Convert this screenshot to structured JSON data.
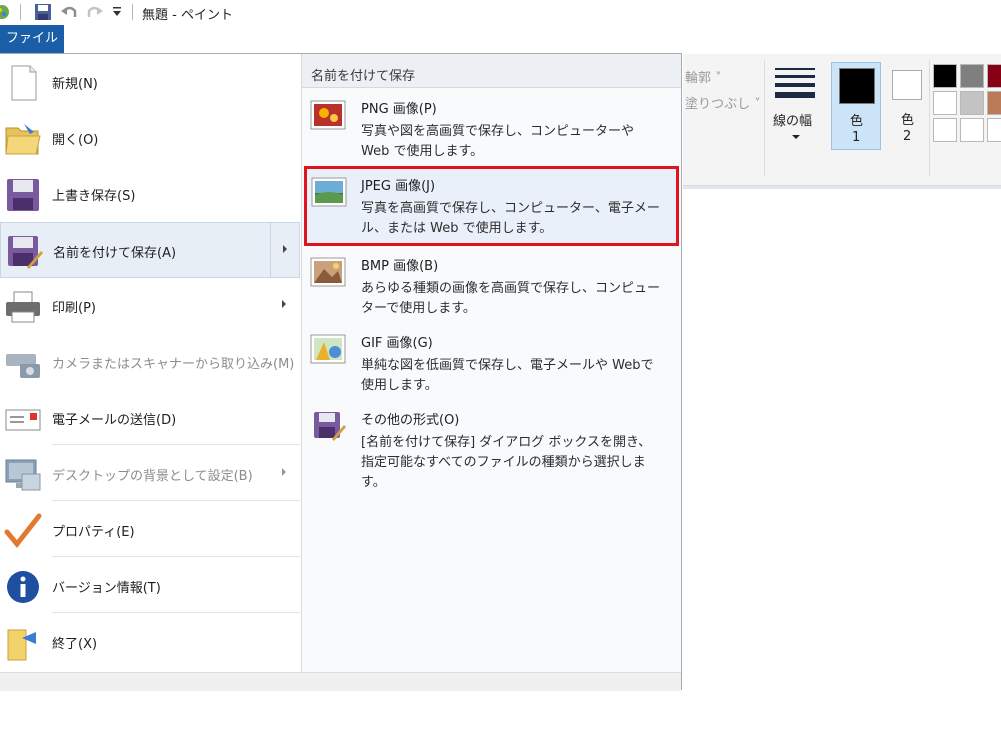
{
  "titlebar": {
    "title": "無題 - ペイント"
  },
  "file_tab": {
    "label": "ファイル"
  },
  "ribbon": {
    "outline_label": "輪郭 ˅",
    "fill_label": "塗りつぶし ˅",
    "line_width_label": "線の幅",
    "color1_label": "色",
    "color1_num": "1",
    "color2_label": "色",
    "color2_num": "2",
    "swatch_colors": [
      "#000000",
      "#7f7f7f",
      "#880015",
      "#ffffff",
      "#c3c3c3",
      "#b97a57",
      "#ffffff",
      "#ffffff",
      "#ffffff"
    ]
  },
  "left_menu": {
    "new": "新規(N)",
    "open": "開く(O)",
    "save": "上書き保存(S)",
    "save_as": "名前を付けて保存(A)",
    "print": "印刷(P)",
    "camera": "カメラまたはスキャナーから取り込み(M)",
    "email": "電子メールの送信(D)",
    "desktop": "デスクトップの背景として設定(B)",
    "properties": "プロパティ(E)",
    "about": "バージョン情報(T)",
    "exit": "終了(X)"
  },
  "right_pane": {
    "header": "名前を付けて保存",
    "items": [
      {
        "title": "PNG 画像(P)",
        "desc": "写真や図を高画質で保存し、コンピューターやWeb で使用します。"
      },
      {
        "title": "JPEG 画像(J)",
        "desc": "写真を高画質で保存し、コンピューター、電子メール、または Web で使用します。"
      },
      {
        "title": "BMP 画像(B)",
        "desc": "あらゆる種類の画像を高画質で保存し、コンピューターで使用します。"
      },
      {
        "title": "GIF 画像(G)",
        "desc": "単純な図を低画質で保存し、電子メールや Webで使用します。"
      },
      {
        "title": "その他の形式(O)",
        "desc": "[名前を付けて保存] ダイアログ ボックスを開き、指定可能なすべてのファイルの種類から選択します。"
      }
    ]
  }
}
